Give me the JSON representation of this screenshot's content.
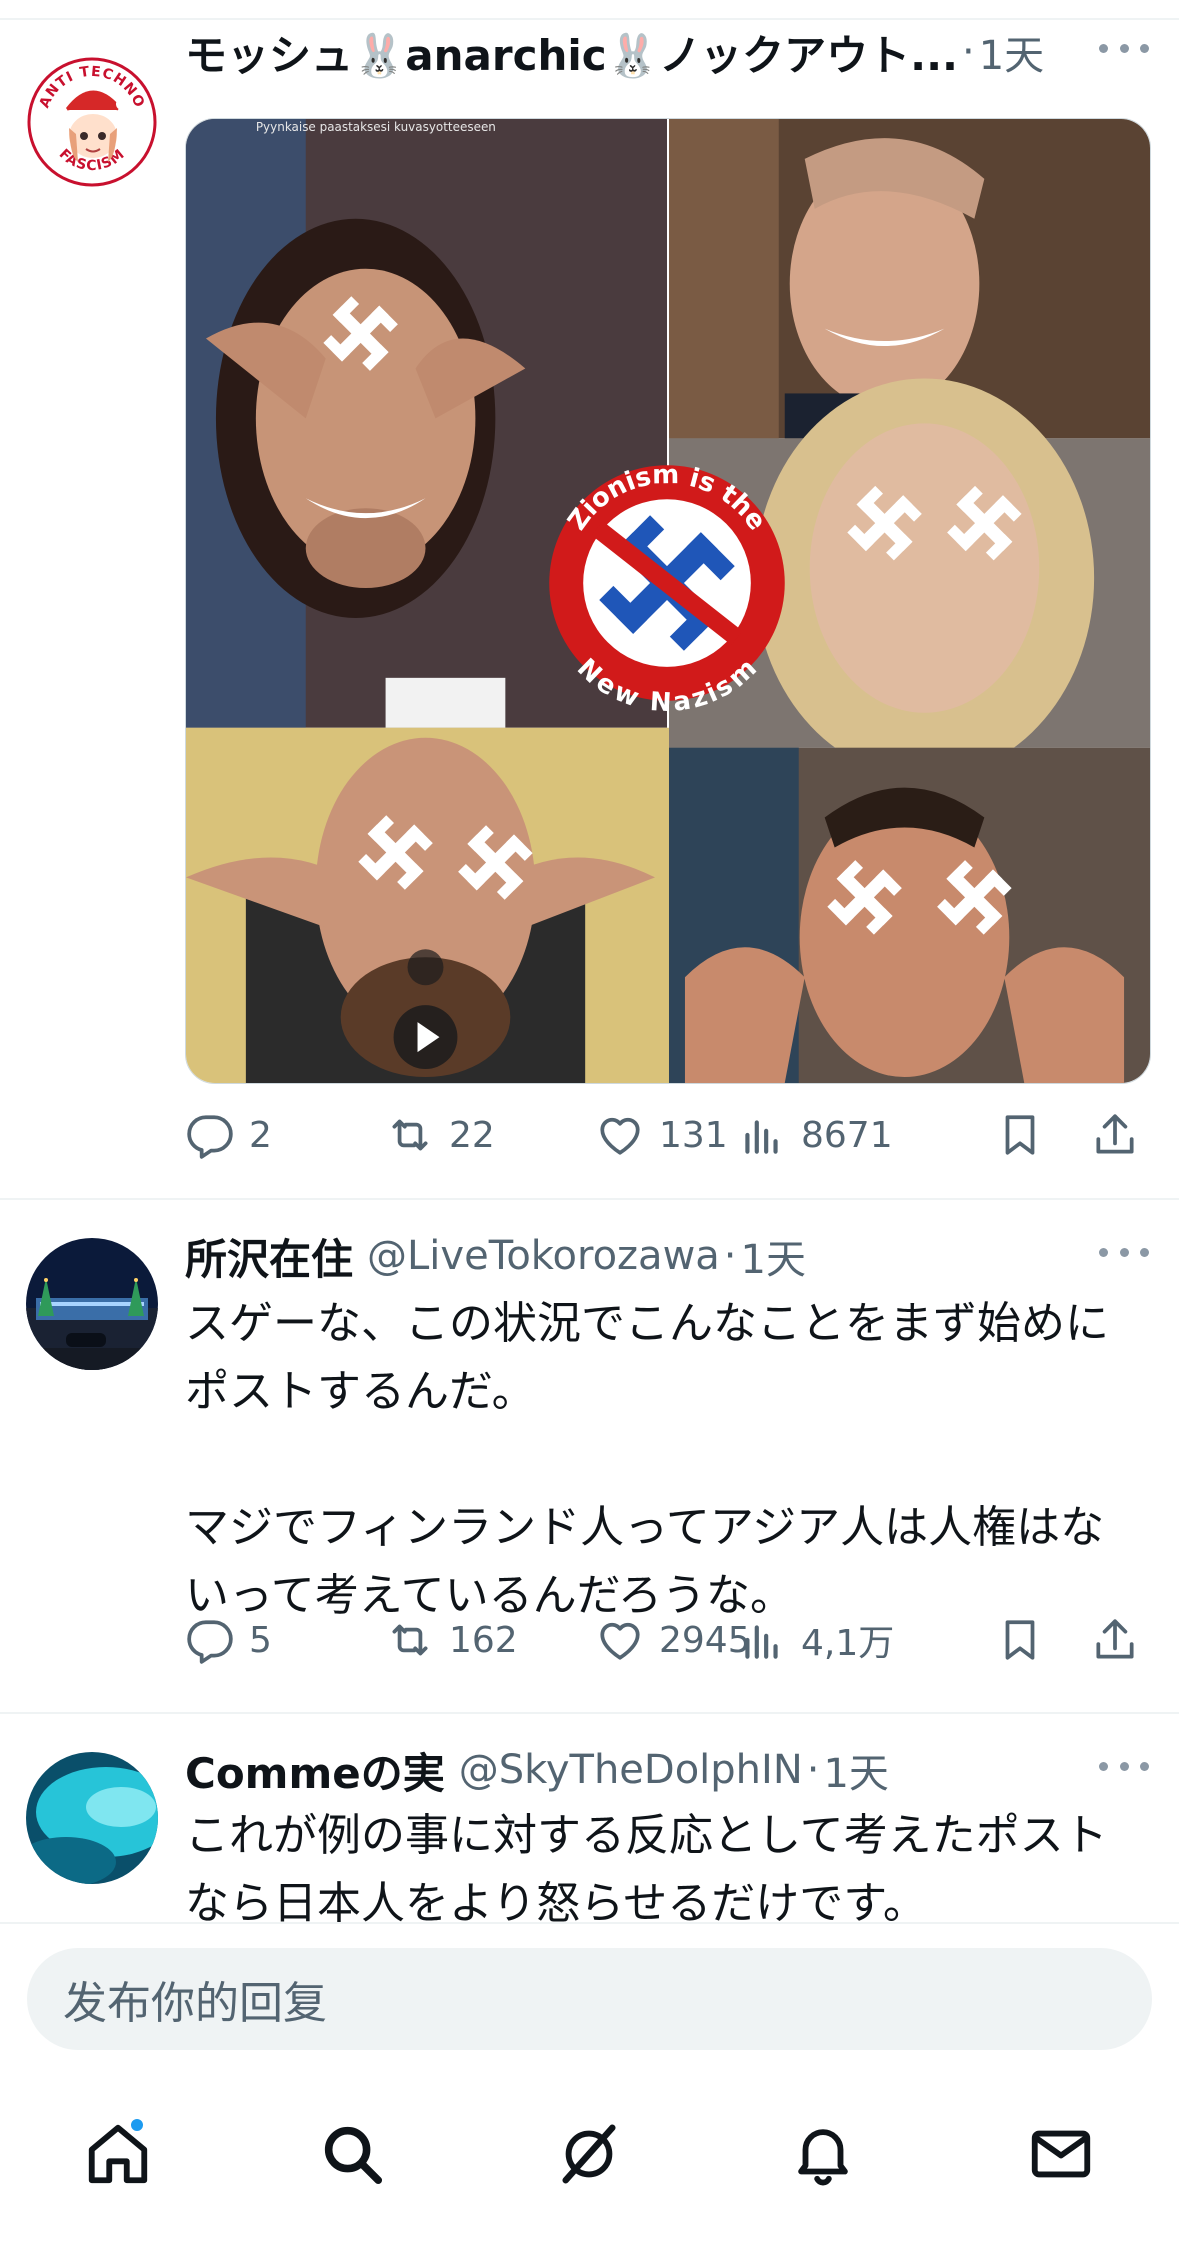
{
  "posts": [
    {
      "display_name": "モッシュ🐰anarchic🐰ノックアウト...",
      "handle": "",
      "separator": "·",
      "time": "1天",
      "text": "",
      "media": {
        "caption_top": "Pyynkaise paastaksesi kuvasyotteeseen",
        "badge_text_top": "Zionism is the",
        "badge_text_bottom": "New Nazism"
      },
      "actions": {
        "replies": "2",
        "reposts": "22",
        "likes": "131",
        "views": "8671"
      },
      "avatar": {
        "text_top": "ANTI TECHNO",
        "text_bottom": "FASCISM"
      }
    },
    {
      "display_name": "所沢在住",
      "handle": "@LiveTokorozawa",
      "separator": "·",
      "time": "1天",
      "text": "スゲーな、この状況でこんなことをまず始めに\nポストするんだ。\n\nマジでフィンランド人ってアジア人は人権はな\nいって考えているんだろうな。",
      "actions": {
        "replies": "5",
        "reposts": "162",
        "likes": "2945",
        "views": "4,1万"
      }
    },
    {
      "display_name": "Commeの実",
      "handle": "@SkyTheDolphIN",
      "separator": "·",
      "time": "1天",
      "text": "これが例の事に対する反応として考えたポスト\nなら日本人をより怒らせるだけです。"
    }
  ],
  "composer": {
    "placeholder": "发布你的回复"
  },
  "tabbar": {
    "items": [
      {
        "icon": "home-icon",
        "has_notification": true
      },
      {
        "icon": "search-icon"
      },
      {
        "icon": "grok-icon"
      },
      {
        "icon": "bell-icon"
      },
      {
        "icon": "mail-icon"
      }
    ]
  },
  "colors": {
    "text_primary": "#0f1419",
    "text_secondary": "#536471",
    "divider": "#eff3f4",
    "accent": "#1d9bf0"
  }
}
